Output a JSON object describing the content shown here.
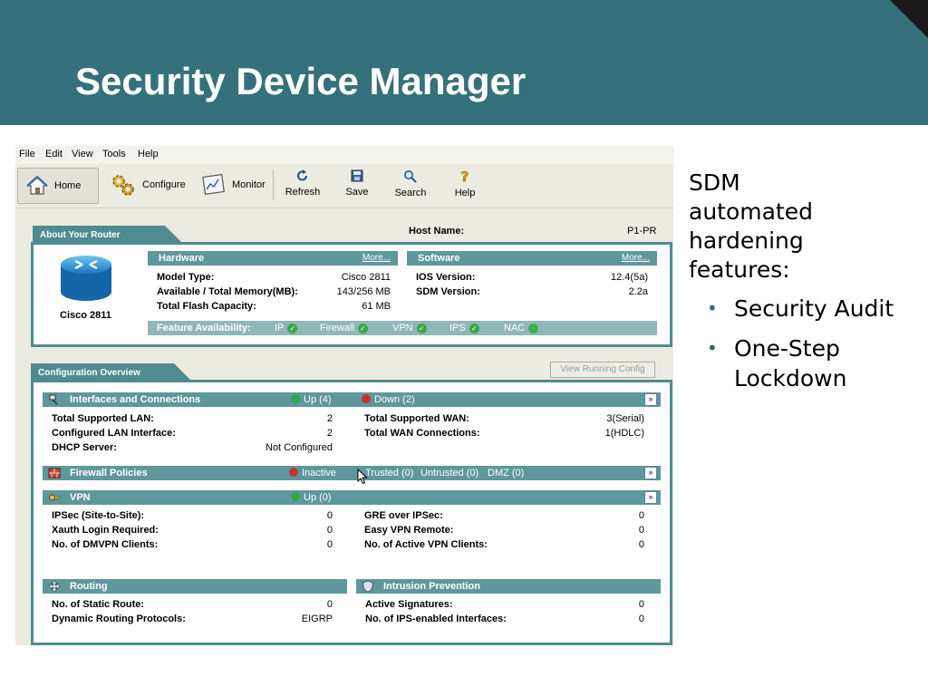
{
  "slide": {
    "title": "Security Device Manager",
    "intro": "SDM automated hardening features:",
    "bullets": [
      "Security Audit",
      "One-Step Lockdown"
    ]
  },
  "colors": {
    "header": "#35717a",
    "panel": "#4f8b91",
    "bar": "#5e979c",
    "ok": "#2fa84a",
    "down": "#c93232"
  },
  "menu": [
    "File",
    "Edit",
    "View",
    "Tools",
    "Help"
  ],
  "toolbar": {
    "home": "Home",
    "configure": "Configure",
    "monitor": "Monitor",
    "refresh": "Refresh",
    "save": "Save",
    "search": "Search",
    "help": "Help"
  },
  "about": {
    "tab": "About Your Router",
    "host_label": "Host Name:",
    "host_value": "P1-PR",
    "router_model": "Cisco 2811",
    "hardware": {
      "title": "Hardware",
      "more": "More...",
      "rows": [
        {
          "label": "Model Type:",
          "value": "Cisco 2811"
        },
        {
          "label": "Available / Total Memory(MB):",
          "value": "143/256 MB"
        },
        {
          "label": "Total Flash Capacity:",
          "value": "61 MB"
        }
      ]
    },
    "software": {
      "title": "Software",
      "more": "More...",
      "rows": [
        {
          "label": "IOS Version:",
          "value": "12.4(5a)"
        },
        {
          "label": "SDM Version:",
          "value": "2.2a"
        }
      ]
    },
    "features": {
      "label": "Feature Availability:",
      "items": [
        "IP",
        "Firewall",
        "VPN",
        "IPS",
        "NAC"
      ]
    }
  },
  "config": {
    "tab": "Configuration Overview",
    "view_running": "View Running Config",
    "interfaces": {
      "title": "Interfaces and Connections",
      "up": "Up (4)",
      "down": "Down (2)",
      "left": [
        {
          "label": "Total Supported LAN:",
          "value": "2"
        },
        {
          "label": "Configured LAN Interface:",
          "value": "2"
        },
        {
          "label": "DHCP Server:",
          "value": "Not Configured"
        }
      ],
      "right": [
        {
          "label": "Total Supported WAN:",
          "value": "3(Serial)"
        },
        {
          "label": "Total WAN Connections:",
          "value": "1(HDLC)"
        }
      ]
    },
    "firewall": {
      "title": "Firewall Policies",
      "inactive": "Inactive",
      "trusted": "Trusted (0)",
      "untrusted": "Untrusted (0)",
      "dmz": "DMZ (0)"
    },
    "vpn": {
      "title": "VPN",
      "up": "Up (0)",
      "left": [
        {
          "label": "IPSec (Site-to-Site):",
          "value": "0"
        },
        {
          "label": "Xauth Login Required:",
          "value": "0"
        },
        {
          "label": "No. of DMVPN Clients:",
          "value": "0"
        }
      ],
      "right": [
        {
          "label": "GRE over IPSec:",
          "value": "0"
        },
        {
          "label": "Easy VPN Remote:",
          "value": "0"
        },
        {
          "label": "No. of Active VPN Clients:",
          "value": "0"
        }
      ]
    },
    "routing": {
      "title": "Routing",
      "rows": [
        {
          "label": "No. of Static Route:",
          "value": "0"
        },
        {
          "label": "Dynamic Routing Protocols:",
          "value": "EIGRP"
        }
      ]
    },
    "ips": {
      "title": "Intrusion Prevention",
      "rows": [
        {
          "label": "Active Signatures:",
          "value": "0"
        },
        {
          "label": "No. of IPS-enabled Interfaces:",
          "value": "0"
        }
      ]
    }
  }
}
